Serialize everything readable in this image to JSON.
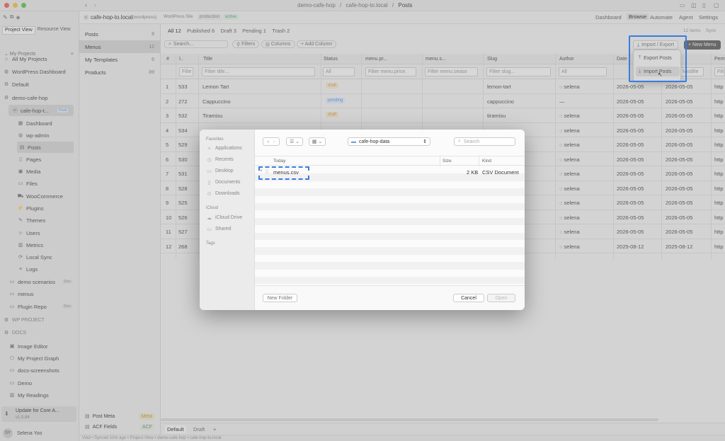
{
  "window": {
    "crumbs": [
      "demo-cafe-hop",
      "cafe-hop-to.local",
      "Posts"
    ]
  },
  "header": {
    "site": "cafe-hop-to.local",
    "site_type": "(wordpress)",
    "site_tag": "WordPress Site",
    "env": "production",
    "status": "active",
    "nav": [
      "Dashboard",
      "Browse",
      "Automate",
      "Agent",
      "Settings"
    ]
  },
  "left": {
    "tabs": [
      "Project View",
      "Resource View"
    ],
    "my_projects": "My Projects",
    "items": [
      {
        "label": "All My Projects",
        "icon": "home-icon"
      },
      {
        "label": "WordPress Dashboard",
        "icon": "globe-icon"
      },
      {
        "label": "Default",
        "icon": "gear-icon"
      },
      {
        "label": "demo-cafe-hop",
        "icon": "gear-icon"
      },
      {
        "label": "cafe-hop-t...",
        "icon": "wordpress-icon",
        "badge": "Pool"
      },
      {
        "label": "Dashboard",
        "icon": "grid-icon"
      },
      {
        "label": "wp-admin",
        "icon": "globe-icon"
      },
      {
        "label": "Posts",
        "icon": "document-icon"
      },
      {
        "label": "Pages",
        "icon": "page-icon"
      },
      {
        "label": "Media",
        "icon": "image-icon"
      },
      {
        "label": "Files",
        "icon": "folder-icon"
      },
      {
        "label": "WooCommerce",
        "icon": "cart-icon"
      },
      {
        "label": "Plugins",
        "icon": "plug-icon"
      },
      {
        "label": "Themes",
        "icon": "brush-icon"
      },
      {
        "label": "Users",
        "icon": "users-icon"
      },
      {
        "label": "Metrics",
        "icon": "chart-icon"
      },
      {
        "label": "Local Sync",
        "icon": "sync-icon"
      },
      {
        "label": "Logs",
        "icon": "list-icon"
      },
      {
        "label": "demo scenarios",
        "icon": "folder-icon",
        "badge": "Dev"
      },
      {
        "label": "menus",
        "icon": "folder-icon"
      },
      {
        "label": "Plugin Repo",
        "icon": "folder-icon",
        "badge": "Dev"
      },
      {
        "label": "WP PROJECT",
        "icon": "gear-icon"
      },
      {
        "label": "DOCS",
        "icon": "gear-icon"
      },
      {
        "label": "Image Editor",
        "icon": "image-icon"
      },
      {
        "label": "My Project Graph",
        "icon": "graph-icon"
      },
      {
        "label": "docs-screenshots",
        "icon": "folder-icon"
      },
      {
        "label": "Demo",
        "icon": "folder-icon"
      },
      {
        "label": "My Readings",
        "icon": "book-icon"
      }
    ],
    "update": {
      "title": "Update for Core A...",
      "version": "v1.0.84"
    },
    "user": {
      "initials": "SY",
      "name": "Selena Yoo"
    }
  },
  "mid": {
    "items": [
      {
        "label": "Posts",
        "count": "8"
      },
      {
        "label": "Menus",
        "count": "12"
      },
      {
        "label": "My Templates",
        "count": "6"
      },
      {
        "label": "Products",
        "count": "89"
      }
    ],
    "bottom": [
      {
        "label": "Post Meta",
        "badge": "Meta"
      },
      {
        "label": "ACF Fields",
        "badge": "ACF"
      }
    ]
  },
  "main": {
    "tabs": [
      "All 12",
      "Published 6",
      "Draft 3",
      "Pending 1",
      "Trash 2"
    ],
    "items_info": "12 items",
    "sync": "Sync",
    "search_placeholder": "Search...",
    "filters": "Filters",
    "columns": "Columns",
    "add_column": "+ Add Column",
    "import_export": "Import / Export",
    "new_menu": "+ New Menu",
    "col_headers": [
      "#",
      "I..",
      "Title",
      "Status",
      "menu.pr...",
      "menu.s...",
      "Slug",
      "Author",
      "Date",
      "...ed",
      "Perm"
    ],
    "filters_row": [
      "Filte",
      "Filter title...",
      "All",
      "Filter menu.price.",
      "Filter menu.seaso",
      "Filter slug...",
      "All",
      "",
      "Modifie",
      "Filt"
    ],
    "rows": [
      {
        "n": "1",
        "id": "533",
        "title": "Lemon Tart",
        "status": "draft",
        "slug": "lemon-tart",
        "author": "selena",
        "date": "2026-05-05",
        "mod": "2026-05-05",
        "perm": "http"
      },
      {
        "n": "2",
        "id": "272",
        "title": "Cappuccino",
        "status": "pending",
        "slug": "cappuccino",
        "author": "—",
        "date": "2026-05-05",
        "mod": "2026-05-05",
        "perm": "http"
      },
      {
        "n": "3",
        "id": "532",
        "title": "Tiramisu",
        "status": "draft",
        "slug": "tiramisu",
        "author": "selena",
        "date": "2026-05-05",
        "mod": "2026-05-05",
        "perm": "http"
      },
      {
        "n": "4",
        "id": "534",
        "title": "",
        "status": "",
        "slug": "",
        "author": "selena",
        "date": "2026-05-05",
        "mod": "2026-05-05",
        "perm": "http"
      },
      {
        "n": "5",
        "id": "529",
        "title": "",
        "status": "",
        "slug": "",
        "author": "selena",
        "date": "2026-05-05",
        "mod": "2026-05-05",
        "perm": "http"
      },
      {
        "n": "6",
        "id": "530",
        "title": "",
        "status": "",
        "slug": "",
        "author": "selena",
        "date": "2026-05-05",
        "mod": "2026-05-05",
        "perm": "http"
      },
      {
        "n": "7",
        "id": "531",
        "title": "",
        "status": "",
        "slug": "",
        "author": "selena",
        "date": "2026-05-05",
        "mod": "2026-05-05",
        "perm": "http"
      },
      {
        "n": "8",
        "id": "528",
        "title": "",
        "status": "",
        "slug": "",
        "author": "selena",
        "date": "2026-05-05",
        "mod": "2026-05-05",
        "perm": "http"
      },
      {
        "n": "9",
        "id": "525",
        "title": "",
        "status": "",
        "slug": "",
        "author": "selena",
        "date": "2026-05-05",
        "mod": "2026-05-05",
        "perm": "http"
      },
      {
        "n": "10",
        "id": "526",
        "title": "",
        "status": "",
        "slug": "",
        "author": "selena",
        "date": "2026-05-05",
        "mod": "2026-05-05",
        "perm": "http"
      },
      {
        "n": "11",
        "id": "527",
        "title": "",
        "status": "",
        "slug": "",
        "author": "selena",
        "date": "2026-05-05",
        "mod": "2026-05-05",
        "perm": "http"
      },
      {
        "n": "12",
        "id": "268",
        "title": "",
        "status": "",
        "slug": "",
        "author": "selena",
        "date": "2025-08-12",
        "mod": "2025-08-12",
        "perm": "http"
      }
    ],
    "bottom_tabs": [
      "Default",
      "Draft",
      "+"
    ]
  },
  "menu": {
    "export": "Export Posts",
    "import": "Import Posts"
  },
  "dialog": {
    "sidebar": {
      "favorites": "Favorites",
      "fav_items": [
        "Applications",
        "Recents",
        "Desktop",
        "Documents",
        "Downloads"
      ],
      "icloud": "iCloud",
      "icloud_items": [
        "iCloud Drive",
        "Shared"
      ],
      "tags": "Tags"
    },
    "location": "cafe-hop-data",
    "search_placeholder": "Search",
    "columns": {
      "name": "Today",
      "size": "Size",
      "kind": "Kind"
    },
    "file": {
      "name": "menus.csv",
      "size": "2 KB",
      "kind": "CSV Document"
    },
    "new_folder": "New Folder",
    "cancel": "Cancel",
    "open": "Open"
  },
  "statusbar": "Void • Synced 10m ago • Project View • demo-cafe-hop • cafe-hop-to.local"
}
